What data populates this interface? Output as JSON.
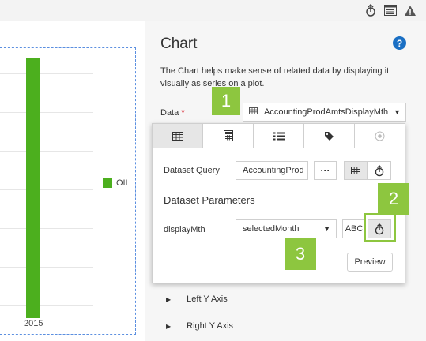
{
  "chart_data": {
    "type": "bar",
    "categories": [
      "2015"
    ],
    "series": [
      {
        "name": "OIL",
        "values": [
          null
        ]
      }
    ],
    "legend_position": "right"
  },
  "panel": {
    "title": "Chart",
    "description": "The Chart helps make sense of related data by displaying it visually as series on a plot.",
    "data_label": "Data",
    "required_mark": "*",
    "data_value": "AccountingProdAmtsDisplayMth",
    "axis_items": [
      "Left Y Axis",
      "Right Y Axis"
    ]
  },
  "popup": {
    "dataset_query_label": "Dataset Query",
    "dataset_query_value": "AccountingProd",
    "more_label": "···",
    "dataset_params_title": "Dataset Parameters",
    "param_name": "displayMth",
    "param_value": "selectedMonth",
    "abc_label": "ABC",
    "preview_label": "Preview"
  },
  "callouts": [
    "1",
    "2",
    "3"
  ],
  "colors": {
    "bar": "#4caf1e",
    "callout": "#8dc63f",
    "help": "#1a6fc4"
  }
}
